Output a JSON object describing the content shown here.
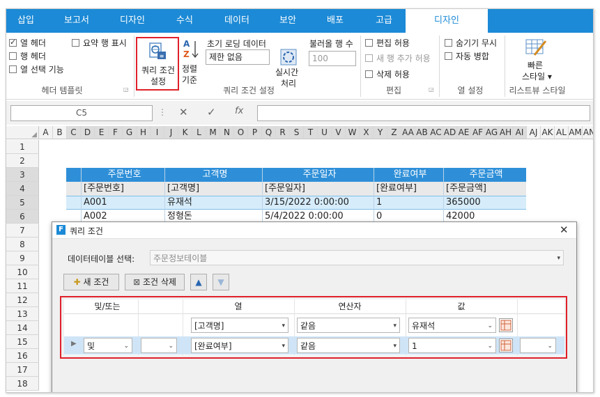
{
  "tabs": [
    "삽입",
    "보고서",
    "디자인",
    "수식",
    "데이터",
    "보안",
    "배포",
    "고급",
    "디자인"
  ],
  "ribbon": {
    "header_template": {
      "col_header": "열 헤더",
      "row_header": "행 헤더",
      "col_select": "열 선택 기능",
      "summary_row": "요약 행 표시",
      "group": "헤더 템플릿"
    },
    "query": {
      "query_btn_line1": "쿼리 조건",
      "query_btn_line2": "설정",
      "sort_line1": "정렬",
      "sort_line2": "기준",
      "initial_loading_label": "초기 로딩 데이터",
      "initial_loading_value": "제한 없음",
      "realtime_line1": "실시간",
      "realtime_line2": "처리",
      "fetch_rows_label": "불러올 행 수",
      "fetch_rows_value": "100",
      "group": "쿼리 조건 설정"
    },
    "edit": {
      "edit_allow": "편집 허용",
      "add_row_allow": "새 행 추가 허용",
      "delete_allow": "삭제 허용",
      "group": "편집"
    },
    "column_settings": {
      "ignore_hide": "숨기기 무시",
      "auto_merge": "자동 병합",
      "group": "열 설정"
    },
    "listview_style": {
      "quick_style_line1": "빠른",
      "quick_style_line2": "스타일 ▾",
      "group": "리스트뷰 스타일"
    }
  },
  "formula_bar": {
    "name_box": "C5",
    "cancel": "✕",
    "confirm": "✓",
    "fx": "fx"
  },
  "grid": {
    "columns": [
      "A",
      "B",
      "C",
      "D",
      "E",
      "F",
      "G",
      "H",
      "I",
      "J",
      "K",
      "L",
      "M",
      "N",
      "O",
      "P",
      "Q",
      "R",
      "S",
      "T",
      "U",
      "V",
      "W",
      "X",
      "Y",
      "Z",
      "AA",
      "AB",
      "AC",
      "AD",
      "AE",
      "AF",
      "AG",
      "AH",
      "AI",
      "AJ",
      "AK",
      "AL",
      "AM",
      "AN"
    ],
    "rows": [
      "1",
      "2",
      "3",
      "4",
      "5",
      "6",
      "7",
      "8",
      "9",
      "10",
      "11",
      "12",
      "13",
      "14",
      "15",
      "16",
      "17",
      "18"
    ],
    "table": {
      "headers": [
        "주문번호",
        "고객명",
        "주문일자",
        "완료여부",
        "주문금액"
      ],
      "bindings": [
        "[주문번호]",
        "[고객명]",
        "[주문일자]",
        "[완료여부]",
        "[주문금액]"
      ],
      "row1": [
        "A001",
        "유재석",
        "3/15/2022 0:00:00",
        "1",
        "365000"
      ],
      "row2": [
        "A002",
        "정형돈",
        "5/4/2022 0:00:00",
        "0",
        "42000"
      ]
    }
  },
  "dialog": {
    "title": "쿼리 조건",
    "close": "✕",
    "table_label": "데이터테이블 선택:",
    "table_value": "주문정보테이블",
    "new_condition": "새 조건",
    "delete_condition": "조건 삭제",
    "grid_headers": {
      "andor": "및/또는",
      "column": "열",
      "operator": "연산자",
      "value": "값"
    },
    "rows": [
      {
        "andor": "",
        "group": "",
        "column": "[고객명]",
        "operator": "같음",
        "value": "유재석",
        "extra": ""
      },
      {
        "andor": "및",
        "group": "",
        "column": "[완료여부]",
        "operator": "같음",
        "value": "1",
        "extra": ""
      }
    ]
  },
  "colors": {
    "accent": "#1c8ad6",
    "highlight": "#e0202a",
    "table_header": "#2e8fd8",
    "table_selected_row": "#d6ecfa"
  }
}
